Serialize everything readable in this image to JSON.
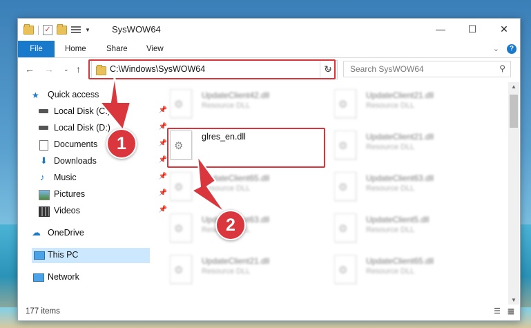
{
  "window": {
    "title": "SysWOW64",
    "minimize_label": "—",
    "maximize_label": "☐",
    "close_label": "✕"
  },
  "ribbon": {
    "tabs": [
      "File",
      "Home",
      "Share",
      "View"
    ],
    "help_label": "?"
  },
  "address": {
    "path": "C:\\Windows\\SysWOW64",
    "refresh_label": "↻"
  },
  "search": {
    "placeholder": "Search SysWOW64"
  },
  "sidebar": {
    "items": [
      {
        "label": "Quick access",
        "icon": "star-icon",
        "pinned": false
      },
      {
        "label": "Local Disk (C:)",
        "icon": "drive-icon",
        "pinned": true
      },
      {
        "label": "Local Disk (D:)",
        "icon": "drive-icon",
        "pinned": true
      },
      {
        "label": "Documents",
        "icon": "documents-icon",
        "pinned": true
      },
      {
        "label": "Downloads",
        "icon": "downloads-icon",
        "pinned": true
      },
      {
        "label": "Music",
        "icon": "music-icon",
        "pinned": true
      },
      {
        "label": "Pictures",
        "icon": "pictures-icon",
        "pinned": true
      },
      {
        "label": "Videos",
        "icon": "videos-icon",
        "pinned": true
      },
      {
        "label": "OneDrive",
        "icon": "cloud-icon",
        "pinned": false
      },
      {
        "label": "This PC",
        "icon": "computer-icon",
        "pinned": false,
        "selected": true
      },
      {
        "label": "Network",
        "icon": "network-icon",
        "pinned": false
      }
    ]
  },
  "files": [
    {
      "name": "UpdateClient42.dll",
      "type": "Resource DLL"
    },
    {
      "name": "UpdateClient21.dll",
      "type": "Resource DLL"
    },
    {
      "name": "glres_en.dll",
      "type": "",
      "highlighted": true
    },
    {
      "name": "UpdateClient21.dll",
      "type": "Resource DLL"
    },
    {
      "name": "UpdateClient65.dll",
      "type": "Resource DLL"
    },
    {
      "name": "UpdateClient63.dll",
      "type": "Resource DLL"
    },
    {
      "name": "UpdateClient63.dll",
      "type": "Resource DLL"
    },
    {
      "name": "UpdateClient5.dll",
      "type": "Resource DLL"
    },
    {
      "name": "UpdateClient21.dll",
      "type": "Resource DLL"
    },
    {
      "name": "UpdateClient65.dll",
      "type": "Resource DLL"
    }
  ],
  "status": {
    "item_count": "177 items"
  },
  "annotations": {
    "step1": "1",
    "step2": "2",
    "color": "#d9363e"
  }
}
